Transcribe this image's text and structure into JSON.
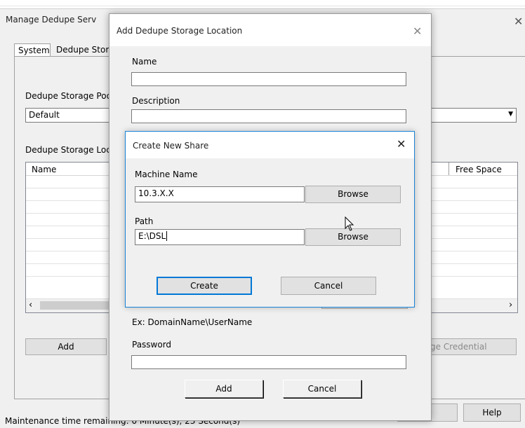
{
  "background_window": {
    "faded_header": [
      "",
      ""
    ],
    "title": "Manage Dedupe Serv",
    "tabs": [
      "System",
      "Dedupe Stor"
    ],
    "pool_label": "Dedupe Storage Poo",
    "pool_value": "Default",
    "locations_label": "Dedupe Storage Loc",
    "columns": [
      "Name",
      "Free Space"
    ],
    "add_button": "Add",
    "change_credential_button": "ge Credential",
    "close_button": "se",
    "help_button": "Help",
    "status": "Maintenance time remaining: 0 Minute(s), 23 Second(s)"
  },
  "add_location_dialog": {
    "title": "Add Dedupe Storage Location",
    "name_label": "Name",
    "name_value": "",
    "description_label": "Description",
    "description_value": "",
    "username_hint": "Ex: DomainName\\UserName",
    "password_label": "Password",
    "password_value": "",
    "add_button": "Add",
    "cancel_button": "Cancel"
  },
  "share_dialog": {
    "title": "Create New Share",
    "machine_label": "Machine Name",
    "machine_value": "10.3.X.X",
    "browse_button": "Browse",
    "path_label": "Path",
    "path_value": "E:\\DSL",
    "create_button": "Create",
    "cancel_button": "Cancel"
  }
}
